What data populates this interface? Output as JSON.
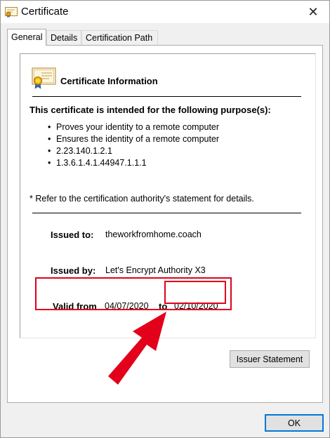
{
  "window": {
    "title": "Certificate"
  },
  "tabs": [
    {
      "label": "General",
      "active": true
    },
    {
      "label": "Details",
      "active": false
    },
    {
      "label": "Certification Path",
      "active": false
    }
  ],
  "info": {
    "title": "Certificate Information",
    "purpose_heading": "This certificate is intended for the following purpose(s):",
    "purposes": [
      "Proves your identity to a remote computer",
      "Ensures the identity of a remote computer",
      "2.23.140.1.2.1",
      "1.3.6.1.4.1.44947.1.1.1"
    ],
    "footnote": "* Refer to the certification authority's statement for details.",
    "issued_to_label": "Issued to:",
    "issued_to": "theworkfromhome.coach",
    "issued_by_label": "Issued by:",
    "issued_by": "Let's Encrypt Authority X3",
    "valid_from_label": "Valid from",
    "valid_from": "04/07/2020",
    "to_label": "to",
    "valid_to": "02/10/2020"
  },
  "buttons": {
    "issuer_statement": "Issuer Statement",
    "ok": "OK"
  },
  "colors": {
    "highlight": "#e2001a",
    "focus": "#0078d7"
  }
}
